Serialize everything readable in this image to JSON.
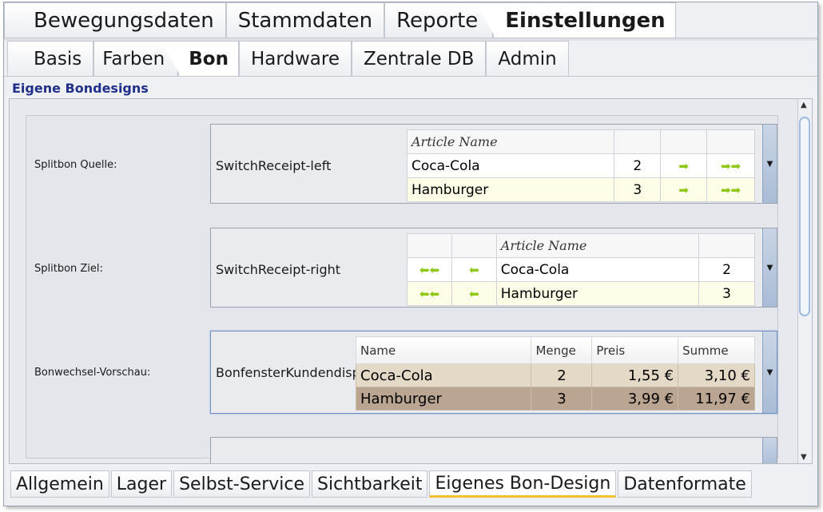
{
  "main_tabs": [
    "Bewegungsdaten",
    "Stammdaten",
    "Reporte",
    "Einstellungen"
  ],
  "sub_tabs": [
    "Basis",
    "Farben",
    "Bon",
    "Hardware",
    "Zentrale DB",
    "Admin"
  ],
  "section_title": "Eigene Bondesigns",
  "rows": [
    {
      "label": "Splitbon Quelle:",
      "design": "SwitchReceipt-left",
      "header": "Article Name",
      "items": [
        {
          "name": "Coca-Cola",
          "qty": "2"
        },
        {
          "name": "Hamburger",
          "qty": "3"
        }
      ]
    },
    {
      "label": "Splitbon Ziel:",
      "design": "SwitchReceipt-right",
      "header": "Article Name",
      "items": [
        {
          "name": "Coca-Cola",
          "qty": "2"
        },
        {
          "name": "Hamburger",
          "qty": "3"
        }
      ]
    },
    {
      "label": "Bonwechsel-Vorschau:",
      "design": "BonfensterKundendisplay",
      "columns": [
        "Name",
        "Menge",
        "Preis",
        "Summe"
      ],
      "items": [
        {
          "name": "Coca-Cola",
          "qty": "2",
          "price": "1,55 €",
          "sum": "3,10 €"
        },
        {
          "name": "Hamburger",
          "qty": "3",
          "price": "3,99 €",
          "sum": "11,97 €"
        }
      ]
    }
  ],
  "icons": {
    "dropdown": "dropdown-arrow-icon",
    "move_right": "arrow-right-icon",
    "move_all_right": "double-arrow-right-icon",
    "move_left": "arrow-left-icon",
    "move_all_left": "double-arrow-left-icon"
  },
  "bottom_tabs": [
    "Allgemein",
    "Lager",
    "Selbst-Service",
    "Sichtbarkeit",
    "Eigenes Bon-Design",
    "Datenformate"
  ],
  "colors": {
    "title": "#1f2f8a",
    "arrow": "#8cc814",
    "preview_row1": "#e3d9c6",
    "preview_row2": "#b9a591",
    "active_bottom_tab": "#f2c030"
  }
}
